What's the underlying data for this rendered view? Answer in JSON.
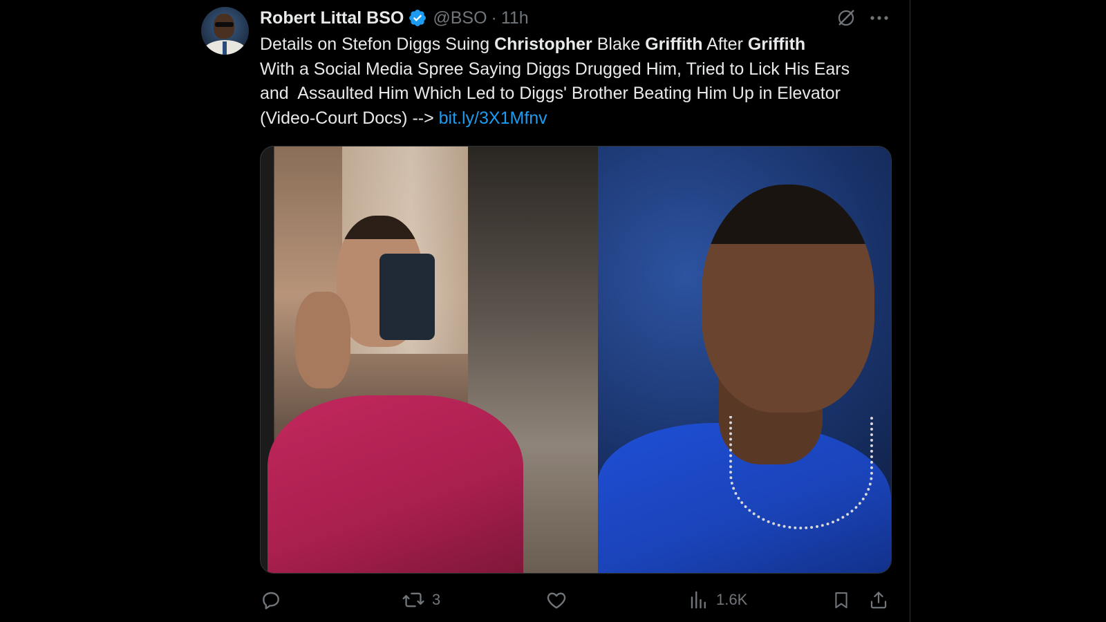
{
  "tweet": {
    "author_name": "Robert Littal BSO",
    "handle": "@BSO",
    "separator": "·",
    "time": "11h",
    "text_segments": [
      {
        "text": "Details on Stefon Diggs Suing ",
        "bold": false,
        "link": false
      },
      {
        "text": "Christopher",
        "bold": true,
        "link": false
      },
      {
        "text": " Blake ",
        "bold": false,
        "link": false
      },
      {
        "text": "Griffith",
        "bold": true,
        "link": false
      },
      {
        "text": " After ",
        "bold": false,
        "link": false
      },
      {
        "text": "Griffith",
        "bold": true,
        "link": false
      },
      {
        "text": "\nWith a Social Media Spree Saying Diggs Drugged Him, Tried to Lick His Ears\nand  Assaulted Him Which Led to Diggs' Brother Beating Him Up in Elevator\n(Video-Court Docs) --> ",
        "bold": false,
        "link": false
      },
      {
        "text": "bit.ly/3X1Mfnv",
        "bold": false,
        "link": true
      }
    ]
  },
  "actions": {
    "reply_count": "",
    "retweet_count": "3",
    "like_count": "",
    "views_count": "1.6K"
  },
  "icons": {
    "verified": "verified-badge-icon",
    "grok": "grok-icon",
    "more": "more-icon",
    "reply": "reply-icon",
    "retweet": "retweet-icon",
    "like": "like-icon",
    "views": "views-icon",
    "bookmark": "bookmark-icon",
    "share": "share-icon"
  },
  "colors": {
    "background": "#000000",
    "text": "#e7e9ea",
    "muted": "#71767b",
    "link": "#1d9bf0",
    "verified": "#1d9bf0"
  }
}
